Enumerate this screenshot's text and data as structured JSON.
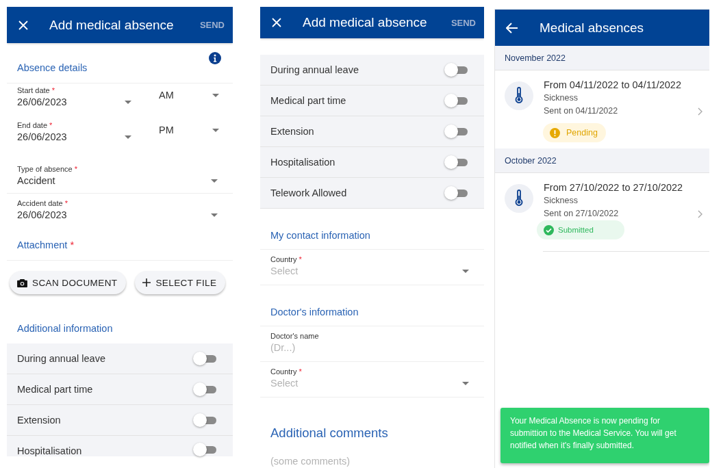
{
  "form_screen": {
    "header": {
      "title": "Add medical absence",
      "action": "SEND",
      "action_disabled": true
    },
    "section_title": "Absence details",
    "date_fields": [
      {
        "label": "Start date",
        "required_mark": "*",
        "value": "26/06/2023",
        "period": "AM"
      },
      {
        "label": "End date",
        "required_mark": "*",
        "value": "26/06/2023",
        "period": "PM"
      }
    ],
    "type_field": {
      "label": "Type of absence",
      "required_mark": "*",
      "value": "Accident"
    },
    "accident_field": {
      "label": "Accident date",
      "required_mark": "*",
      "value": "26/06/2023"
    },
    "attachment": {
      "title": "Attachment",
      "required_mark": "*",
      "buttons": [
        {
          "label": "SCAN DOCUMENT",
          "kind": "scan"
        },
        {
          "label": "SELECT FILE",
          "kind": "select"
        }
      ]
    },
    "additional_title": "Additional information",
    "toggles": [
      {
        "label": "During annual leave",
        "on": false
      },
      {
        "label": "Medical part time",
        "on": false
      },
      {
        "label": "Extension",
        "on": false
      },
      {
        "label": "Hospitalisation",
        "on": false
      }
    ]
  },
  "form_screen_scrolled": {
    "header": {
      "title": "Add medical absence",
      "action": "SEND",
      "action_disabled": true
    },
    "toggles": [
      {
        "label": "During annual leave",
        "on": false
      },
      {
        "label": "Medical part time",
        "on": false
      },
      {
        "label": "Extension",
        "on": false
      },
      {
        "label": "Hospitalisation",
        "on": false
      },
      {
        "label": "Telework Allowed",
        "on": false
      }
    ],
    "sections": [
      {
        "title": "My contact information",
        "fields": [
          {
            "kind": "select",
            "label": "Country",
            "required_mark": "*",
            "placeholder": "Select"
          }
        ]
      },
      {
        "title": "Doctor's information",
        "fields": [
          {
            "kind": "text",
            "label": "Doctor's name",
            "placeholder": "(Dr...)"
          },
          {
            "kind": "select",
            "label": "Country",
            "required_mark": "*",
            "placeholder": "Select"
          }
        ]
      }
    ],
    "comments": {
      "title": "Additional comments",
      "placeholder": "(some comments)"
    }
  },
  "list_screen": {
    "header": {
      "title": "Medical absences"
    },
    "groups": [
      {
        "month": "November 2022",
        "items": [
          {
            "title": "From 04/11/2022 to 04/11/2022",
            "type": "Sickness",
            "sent": "Sent on 04/11/2022",
            "status": {
              "kind": "pending",
              "label": "Pending"
            }
          }
        ]
      },
      {
        "month": "October 2022",
        "items": [
          {
            "title": "From 27/10/2022 to 27/10/2022",
            "type": "Sickness",
            "sent": "Sent on 27/10/2022",
            "status": {
              "kind": "submitted",
              "label": "Submitted"
            }
          }
        ]
      }
    ],
    "toast": {
      "message": "Your Medical Absence is now pending for submittion to the Medical Service. You will get notified when it's finally submitted."
    }
  }
}
